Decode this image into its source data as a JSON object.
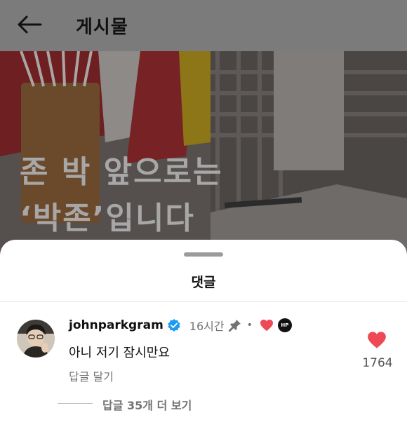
{
  "header": {
    "title": "게시물",
    "back_icon": "arrow-left-icon"
  },
  "post": {
    "headline_line1": "존 박 앞으로는",
    "headline_line2": "‘박존’입니다"
  },
  "comments_sheet": {
    "title": "댓글",
    "comment": {
      "username": "johnparkgram",
      "verified": true,
      "time_ago": "16시간",
      "badge_text": "HP",
      "text": "아니 저기 잠시만요",
      "reply_label": "답글 달기",
      "like_count": "1764",
      "liked": true
    },
    "more_replies": "답글 35개 더 보기"
  },
  "colors": {
    "accent_red": "#ed4956",
    "verified_blue": "#1d9bf0",
    "muted_text": "#737373"
  }
}
